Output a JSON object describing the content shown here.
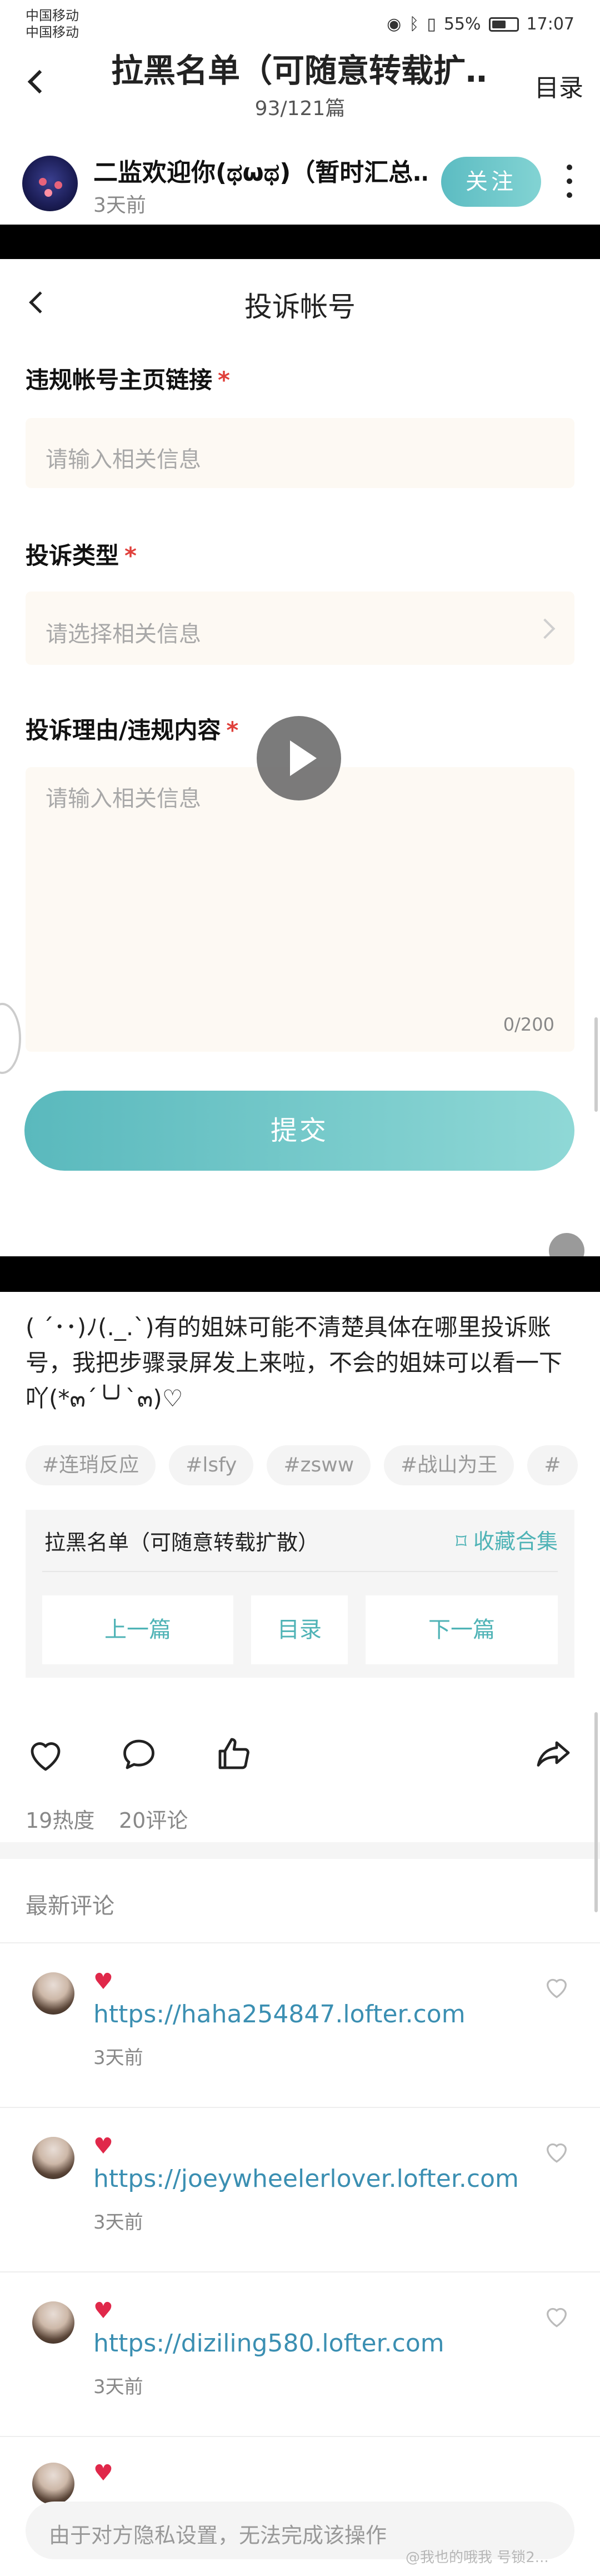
{
  "status_bar": {
    "carrier_1": "中国移动",
    "carrier_2": "中国移动",
    "battery": "55%",
    "time": "17:07"
  },
  "topbar": {
    "title": "拉黑名单（可随意转载扩…",
    "subtitle": "93/121篇",
    "catalog": "目录"
  },
  "author": {
    "name": "二监欢迎你(ಥωಥ)（暂时汇总…",
    "time": "3天前",
    "follow": "关注"
  },
  "video": {
    "screen_title": "投诉帐号",
    "fields": [
      {
        "label": "违规帐号主页链接",
        "required": "*",
        "placeholder": "请输入相关信息"
      },
      {
        "label": "投诉类型",
        "required": "*",
        "placeholder": "请选择相关信息"
      },
      {
        "label": "投诉理由/违规内容",
        "required": "*",
        "placeholder": "请输入相关信息",
        "counter": "0/200"
      }
    ],
    "submit": "提交"
  },
  "post": {
    "text": "( ´･･)ﾉ(._.`)有的姐妹可能不清楚具体在哪里投诉账号，我把步骤录屏发上来啦，不会的姐妹可以看一下吖(*๓´╰╯`๓)♡",
    "tags": [
      "#连琑反应",
      "#lsfy",
      "#zsww",
      "#战山为王",
      "#"
    ]
  },
  "collection": {
    "title": "拉黑名单（可随意转载扩散）",
    "favorite": "收藏合集",
    "prev": "上一篇",
    "catalog": "目录",
    "next": "下一篇"
  },
  "stats": {
    "heat": "19热度",
    "comments": "20评论"
  },
  "comments_section": {
    "title": "最新评论",
    "items": [
      {
        "text": "https://haha254847.lofter.com",
        "time": "3天前"
      },
      {
        "text": "https://joeywheelerlover.lofter.com",
        "time": "3天前"
      },
      {
        "text": "https://diziling580.lofter.com",
        "time": "3天前"
      }
    ]
  },
  "bottom": {
    "placeholder": "由于对方隐私设置，无法完成该操作"
  },
  "watermark": "@我也的哦我  号锁2...",
  "colors": {
    "accent": "#5cbcc2",
    "required": "#e0403b",
    "link": "#3b8fb2",
    "heart": "#e0284a"
  }
}
